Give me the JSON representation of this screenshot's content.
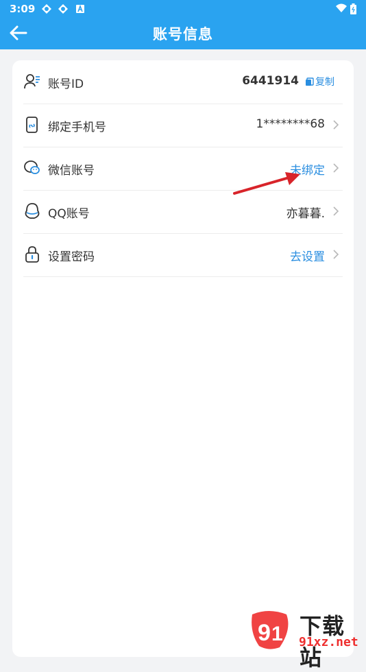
{
  "status_bar": {
    "time": "3:09"
  },
  "header": {
    "title": "账号信息"
  },
  "rows": [
    {
      "label": "账号ID",
      "value": "6441914",
      "action": "复制"
    },
    {
      "label": "绑定手机号",
      "value": "1********68"
    },
    {
      "label": "微信账号",
      "value": "未绑定"
    },
    {
      "label": "QQ账号",
      "value": "亦暮暮."
    },
    {
      "label": "设置密码",
      "value": "去设置"
    }
  ],
  "watermark": {
    "text": "下载站",
    "url": "91xz.net"
  },
  "colors": {
    "header_bg": "#2aa3f0",
    "link": "#2a8ee0",
    "annotation_arrow": "#d8242a"
  }
}
